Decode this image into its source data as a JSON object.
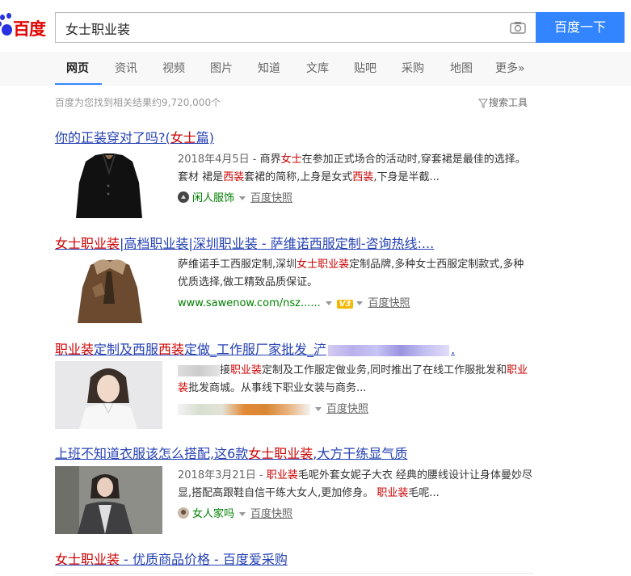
{
  "header": {
    "logo_text": "百度",
    "query": "女士职业装",
    "search_button": "百度一下",
    "camera_icon": "camera-icon"
  },
  "tabs": [
    "网页",
    "资讯",
    "视频",
    "图片",
    "知道",
    "文库",
    "贴吧",
    "采购",
    "地图",
    "更多»"
  ],
  "active_tab": "网页",
  "result_count": "百度为您找到相关结果约9,720,000个",
  "tools_label": "搜索工具",
  "results": [
    {
      "title": [
        "你的正装穿对了吗?(",
        "女士",
        "篇)"
      ],
      "date": "2018年4月5日 - ",
      "snippet": [
        "商界",
        "女士",
        "在参加正式场合的活动时,穿套裙是最佳的选择。套材 裙是",
        "西装",
        "套裙的简称,上身是女式",
        "西装",
        ",下身是半截..."
      ],
      "source": "闲人服饰",
      "snapshot": "百度快照"
    },
    {
      "title": [
        "女士职业装",
        "|高档职业装|深圳职业装 - 萨维诺西服定制-咨询热线:..."
      ],
      "snippet": [
        "萨维诺手工西服定制,深圳",
        "女士职业装",
        "定制品牌,多种女士西服定制款式,多种优质选择,做工精致品质保证。"
      ],
      "source": "www.sawenow.com/nsz......",
      "badge": "V3",
      "snapshot": "百度快照"
    },
    {
      "title": [
        "职业装",
        "定制及西服",
        "西装",
        "定做_工作服厂家批发_浐"
      ],
      "title_tail": ".",
      "snippet": [
        "接",
        "职业装",
        "定制及工作服定做业务,同时推出了在线工作服批发和",
        "职业装",
        "批发商城。从事线下职业女装与商务..."
      ],
      "snapshot": "百度快照"
    },
    {
      "title": [
        "上班不知道衣服该怎么搭配,这6款",
        "女士职业装",
        ",大方干练显气质"
      ],
      "date": "2018年3月21日 - ",
      "snippet": [
        "职业装",
        "毛呢外套女妮子大衣 经典的腰线设计让身体曼妙尽显,搭配高跟鞋自信干练大女人,更加修身。 ",
        "职业装",
        "毛呢..."
      ],
      "source": "女人家吗",
      "snapshot": "百度快照"
    },
    {
      "title": [
        "女士职业装",
        " - 优质商品价格 - 百度爱采购"
      ]
    }
  ]
}
